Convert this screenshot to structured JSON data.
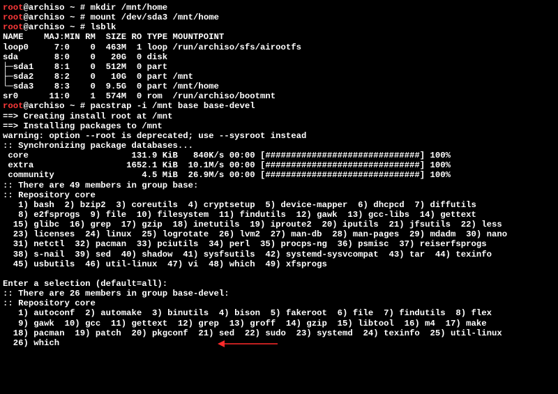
{
  "prompt": {
    "user": "root",
    "host": "@archiso ~ # "
  },
  "cmds": {
    "mkdir": "mkdir /mnt/home",
    "mount": "mount /dev/sda3 /mnt/home",
    "lsblk": "lsblk",
    "pacstrap": "pacstrap -i /mnt base base-devel"
  },
  "lsblk": {
    "header": "NAME    MAJ:MIN RM  SIZE RO TYPE MOUNTPOINT",
    "rows": [
      "loop0     7:0    0  463M  1 loop /run/archiso/sfs/airootfs",
      "sda       8:0    0   20G  0 disk",
      "├─sda1    8:1    0  512M  0 part",
      "├─sda2    8:2    0   10G  0 part /mnt",
      "└─sda3    8:3    0  9.5G  0 part /mnt/home",
      "sr0      11:0    1  574M  0 rom  /run/archiso/bootmnt"
    ]
  },
  "pacstrap": {
    "creating": "==> Creating install root at /mnt",
    "installing": "==> Installing packages to /mnt",
    "warning": "warning: option --root is deprecated; use --sysroot instead",
    "sync": ":: Synchronizing package databases...",
    "dl": [
      " core                    131.9 KiB   840K/s 00:00 [##############################] 100%",
      " extra                  1652.1 KiB  10.1M/s 00:00 [##############################] 100%",
      " community                 4.5 MiB  26.9M/s 00:00 [##############################] 100%"
    ],
    "base_header": ":: There are 49 members in group base:",
    "repo_core": ":: Repository core",
    "base_lines": [
      "   1) bash  2) bzip2  3) coreutils  4) cryptsetup  5) device-mapper  6) dhcpcd  7) diffutils",
      "   8) e2fsprogs  9) file  10) filesystem  11) findutils  12) gawk  13) gcc-libs  14) gettext",
      "  15) glibc  16) grep  17) gzip  18) inetutils  19) iproute2  20) iputils  21) jfsutils  22) less",
      "  23) licenses  24) linux  25) logrotate  26) lvm2  27) man-db  28) man-pages  29) mdadm  30) nano",
      "  31) netctl  32) pacman  33) pciutils  34) perl  35) procps-ng  36) psmisc  37) reiserfsprogs",
      "  38) s-nail  39) sed  40) shadow  41) sysfsutils  42) systemd-sysvcompat  43) tar  44) texinfo",
      "  45) usbutils  46) util-linux  47) vi  48) which  49) xfsprogs"
    ],
    "selection_prompt": "Enter a selection (default=all): ",
    "devel_header": ":: There are 26 members in group base-devel:",
    "devel_lines": [
      "   1) autoconf  2) automake  3) binutils  4) bison  5) fakeroot  6) file  7) findutils  8) flex",
      "   9) gawk  10) gcc  11) gettext  12) grep  13) groff  14) gzip  15) libtool  16) m4  17) make",
      "  18) pacman  19) patch  20) pkgconf  21) sed  22) sudo  23) systemd  24) texinfo  25) util-linux",
      "  26) which"
    ]
  },
  "arrow_color": "#ff2a2a"
}
